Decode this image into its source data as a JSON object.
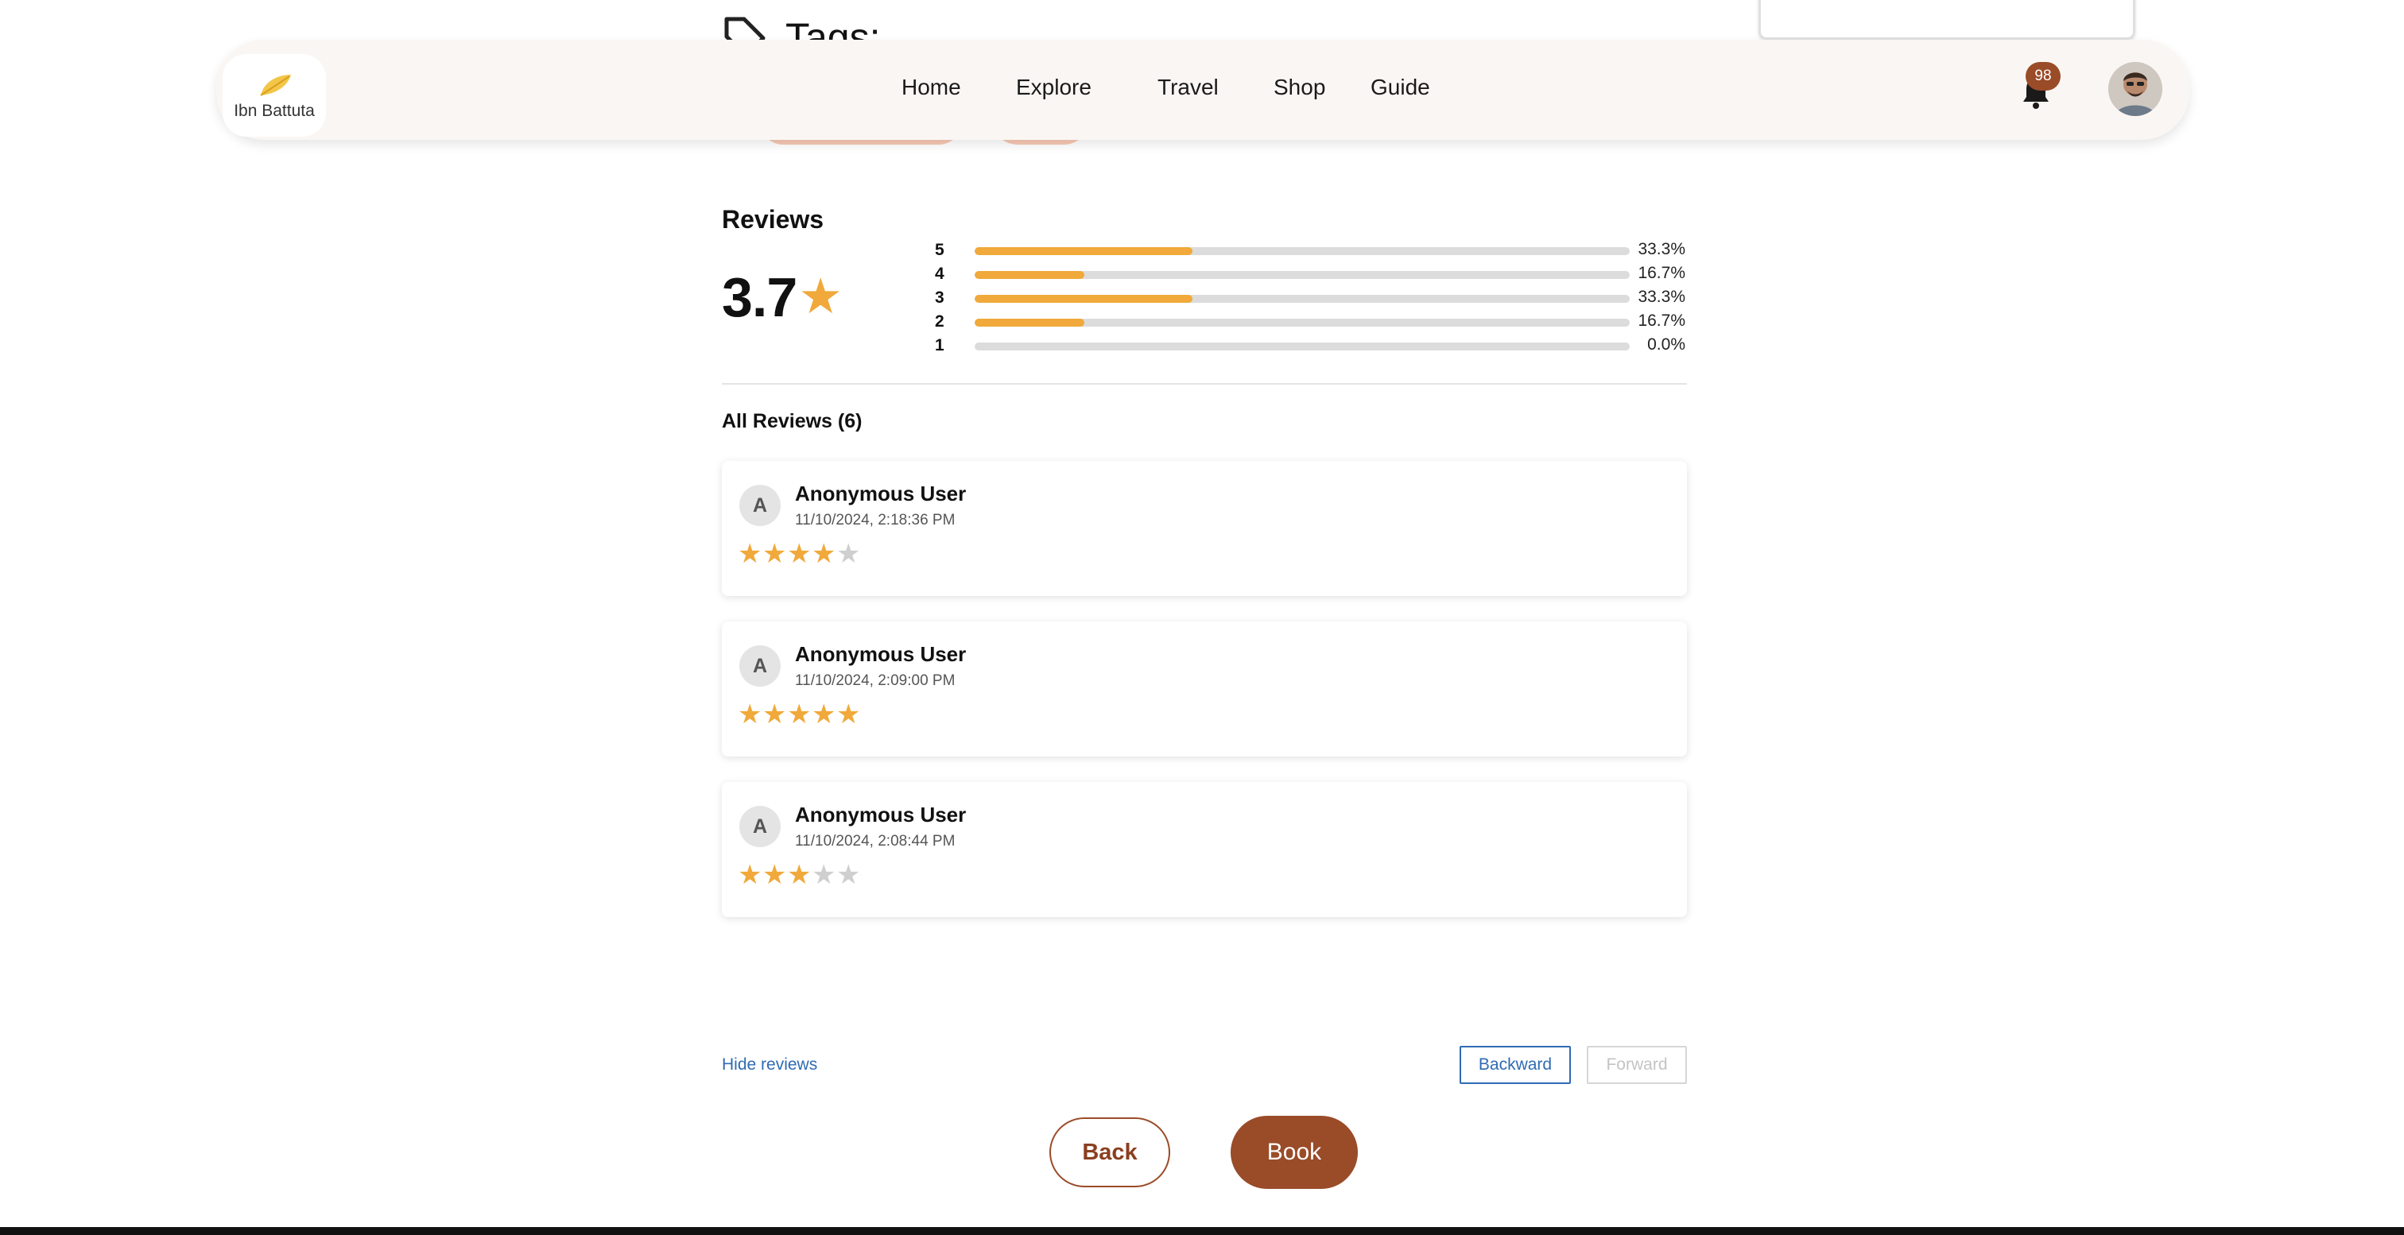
{
  "page": {
    "tags_title": "Tags:"
  },
  "header": {
    "logo_text": "Ibn Battuta",
    "nav": [
      "Home",
      "Explore",
      "Travel",
      "Shop",
      "Guide"
    ],
    "notification_count": "98",
    "icons": {
      "notifications": "bell-icon",
      "profile": "avatar"
    }
  },
  "reviews": {
    "heading": "Reviews",
    "average": "3.7",
    "star_color": "#f0a93a",
    "distribution": [
      {
        "label": "5",
        "percent_text": "33.3%",
        "percent": 33.3
      },
      {
        "label": "4",
        "percent_text": "16.7%",
        "percent": 16.7
      },
      {
        "label": "3",
        "percent_text": "33.3%",
        "percent": 33.3
      },
      {
        "label": "2",
        "percent_text": "16.7%",
        "percent": 16.7
      },
      {
        "label": "1",
        "percent_text": "0.0%",
        "percent": 0
      }
    ],
    "all_reviews_label": "All Reviews (6)",
    "items": [
      {
        "initial": "A",
        "name": "Anonymous User",
        "date": "11/10/2024, 2:18:36 PM",
        "rating": 4
      },
      {
        "initial": "A",
        "name": "Anonymous User",
        "date": "11/10/2024, 2:09:00 PM",
        "rating": 5
      },
      {
        "initial": "A",
        "name": "Anonymous User",
        "date": "11/10/2024, 2:08:44 PM",
        "rating": 3
      }
    ],
    "hide_label": "Hide reviews",
    "backward_label": "Backward",
    "forward_label": "Forward"
  },
  "actions": {
    "back_label": "Back",
    "book_label": "Book",
    "accent_color": "#9a4b28"
  }
}
